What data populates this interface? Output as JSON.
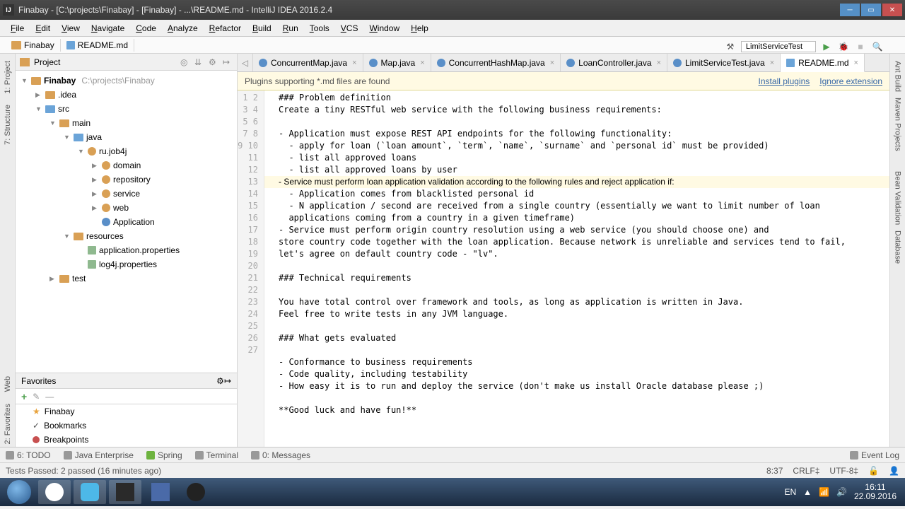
{
  "title": "Finabay - [C:\\projects\\Finabay] - [Finabay] - ...\\README.md - IntelliJ IDEA 2016.2.4",
  "menu": [
    "File",
    "Edit",
    "View",
    "Navigate",
    "Code",
    "Analyze",
    "Refactor",
    "Build",
    "Run",
    "Tools",
    "VCS",
    "Window",
    "Help"
  ],
  "breadcrumb": {
    "root": "Finabay",
    "file": "README.md"
  },
  "run_config": "LimitServiceTest",
  "project": {
    "title": "Project",
    "root": {
      "name": "Finabay",
      "path": "C:\\projects\\Finabay"
    },
    "nodes": {
      "idea": ".idea",
      "src": "src",
      "main": "main",
      "java": "java",
      "pkg": "ru.job4j",
      "domain": "domain",
      "repository": "repository",
      "service": "service",
      "web": "web",
      "app": "Application",
      "resources": "resources",
      "app_props": "application.properties",
      "log4j": "log4j.properties",
      "test": "test"
    }
  },
  "favorites": {
    "title": "Favorites",
    "items": [
      "Finabay",
      "Bookmarks",
      "Breakpoints"
    ]
  },
  "left_tabs": [
    "1: Project",
    "7: Structure"
  ],
  "left_tabs2": [
    "Web",
    "2: Favorites"
  ],
  "right_tabs": [
    "Ant Build",
    "Maven Projects",
    "Bean Validation",
    "Database"
  ],
  "tabs": [
    {
      "name": "ConcurrentMap.java",
      "icon": "j"
    },
    {
      "name": "Map.java",
      "icon": "j"
    },
    {
      "name": "ConcurrentHashMap.java",
      "icon": "j"
    },
    {
      "name": "LoanController.java",
      "icon": "j"
    },
    {
      "name": "LimitServiceTest.java",
      "icon": "j"
    },
    {
      "name": "README.md",
      "icon": "md",
      "active": true
    }
  ],
  "banner": {
    "msg": "Plugins supporting *.md files are found",
    "install": "Install plugins",
    "ignore": "Ignore extension"
  },
  "code_lines": [
    "### Problem definition",
    "Create a tiny RESTful web service with the following business requirements:",
    "",
    "- Application must expose REST API endpoints for the following functionality:",
    "  - apply for loan (`loan amount`, `term`, `name`, `surname` and `personal id` must be provided)",
    "  - list all approved loans",
    "  - list all approved loans by user",
    "- Service must perform loan application validation according to the following rules and reject application if:",
    "  - Application comes from blacklisted personal id",
    "  - N application / second are received from a single country (essentially we want to limit number of loan",
    "  applications coming from a country in a given timeframe)",
    "- Service must perform origin country resolution using a web service (you should choose one) and",
    "store country code together with the loan application. Because network is unreliable and services tend to fail,",
    "let's agree on default country code - \"lv\".",
    "",
    "### Technical requirements",
    "",
    "You have total control over framework and tools, as long as application is written in Java.",
    "Feel free to write tests in any JVM language.",
    "",
    "### What gets evaluated",
    "",
    "- Conformance to business requirements",
    "- Code quality, including testability",
    "- How easy it is to run and deploy the service (don't make us install Oracle database please ;)",
    "",
    "**Good luck and have fun!**"
  ],
  "highlight_line": 8,
  "bottom_tools": [
    "6: TODO",
    "Java Enterprise",
    "Spring",
    "Terminal",
    "0: Messages"
  ],
  "event_log": "Event Log",
  "status": {
    "tests": "Tests Passed: 2 passed (16 minutes ago)",
    "pos": "8:37",
    "sep": "CRLF‡",
    "enc": "UTF-8‡"
  },
  "tray": {
    "lang": "EN",
    "time": "16:11",
    "date": "22.09.2016"
  }
}
